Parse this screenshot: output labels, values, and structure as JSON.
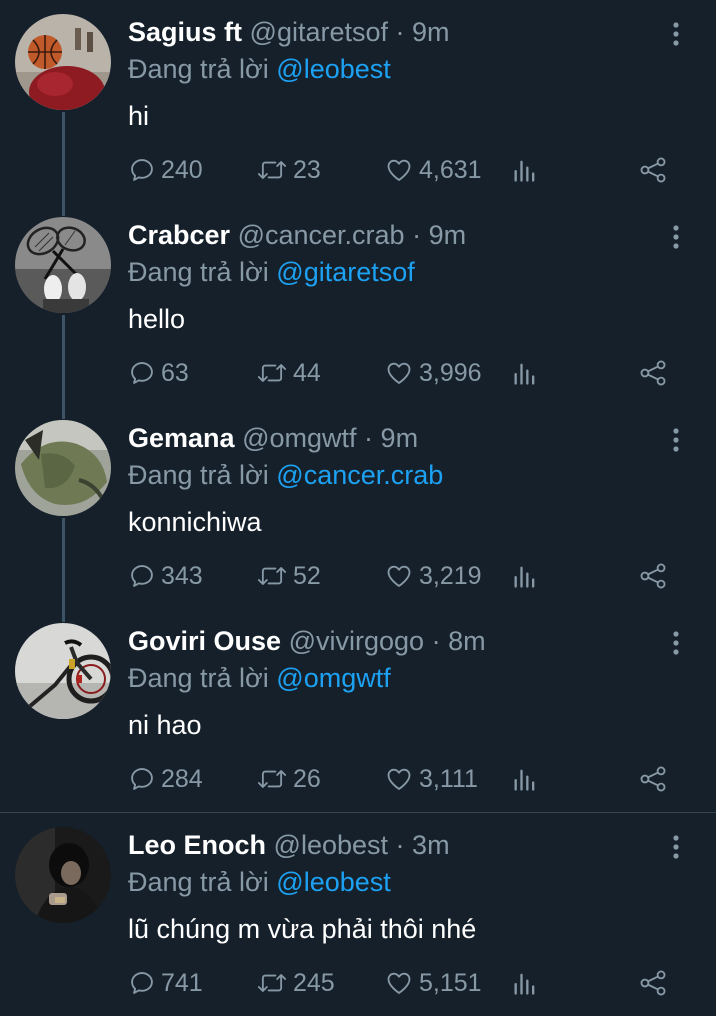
{
  "reply_prefix": "Đang trả lời",
  "tweets": [
    {
      "name": "Sagius ft",
      "handle": "@gitaretsof",
      "time": "9m",
      "reply_to": "@leobest",
      "text": "hi",
      "replies": "240",
      "retweets": "23",
      "likes": "4,631",
      "avatar": "basketball-photo"
    },
    {
      "name": "Crabcer",
      "handle": "@cancer.crab",
      "time": "9m",
      "reply_to": "@gitaretsof",
      "text": "hello",
      "replies": "63",
      "retweets": "44",
      "likes": "3,996",
      "avatar": "badminton-photo"
    },
    {
      "name": "Gemana",
      "handle": "@omgwtf",
      "time": "9m",
      "reply_to": "@cancer.crab",
      "text": "konnichiwa",
      "replies": "343",
      "retweets": "52",
      "likes": "3,219",
      "avatar": "jacket-photo"
    },
    {
      "name": "Goviri Ouse",
      "handle": "@vivirgogo",
      "time": "8m",
      "reply_to": "@omgwtf",
      "text": "ni hao",
      "replies": "284",
      "retweets": "26",
      "likes": "3,111",
      "avatar": "bicycle-photo"
    },
    {
      "name": "Leo Enoch",
      "handle": "@leobest",
      "time": "3m",
      "reply_to": "@leobest",
      "text": "lũ chúng m vừa phải thôi nhé",
      "replies": "741",
      "retweets": "245",
      "likes": "5,151",
      "avatar": "person-photo"
    }
  ],
  "colors": {
    "background": "#15202b",
    "secondary_text": "#8899a6",
    "accent": "#1da1f2",
    "divider": "#38444d"
  }
}
